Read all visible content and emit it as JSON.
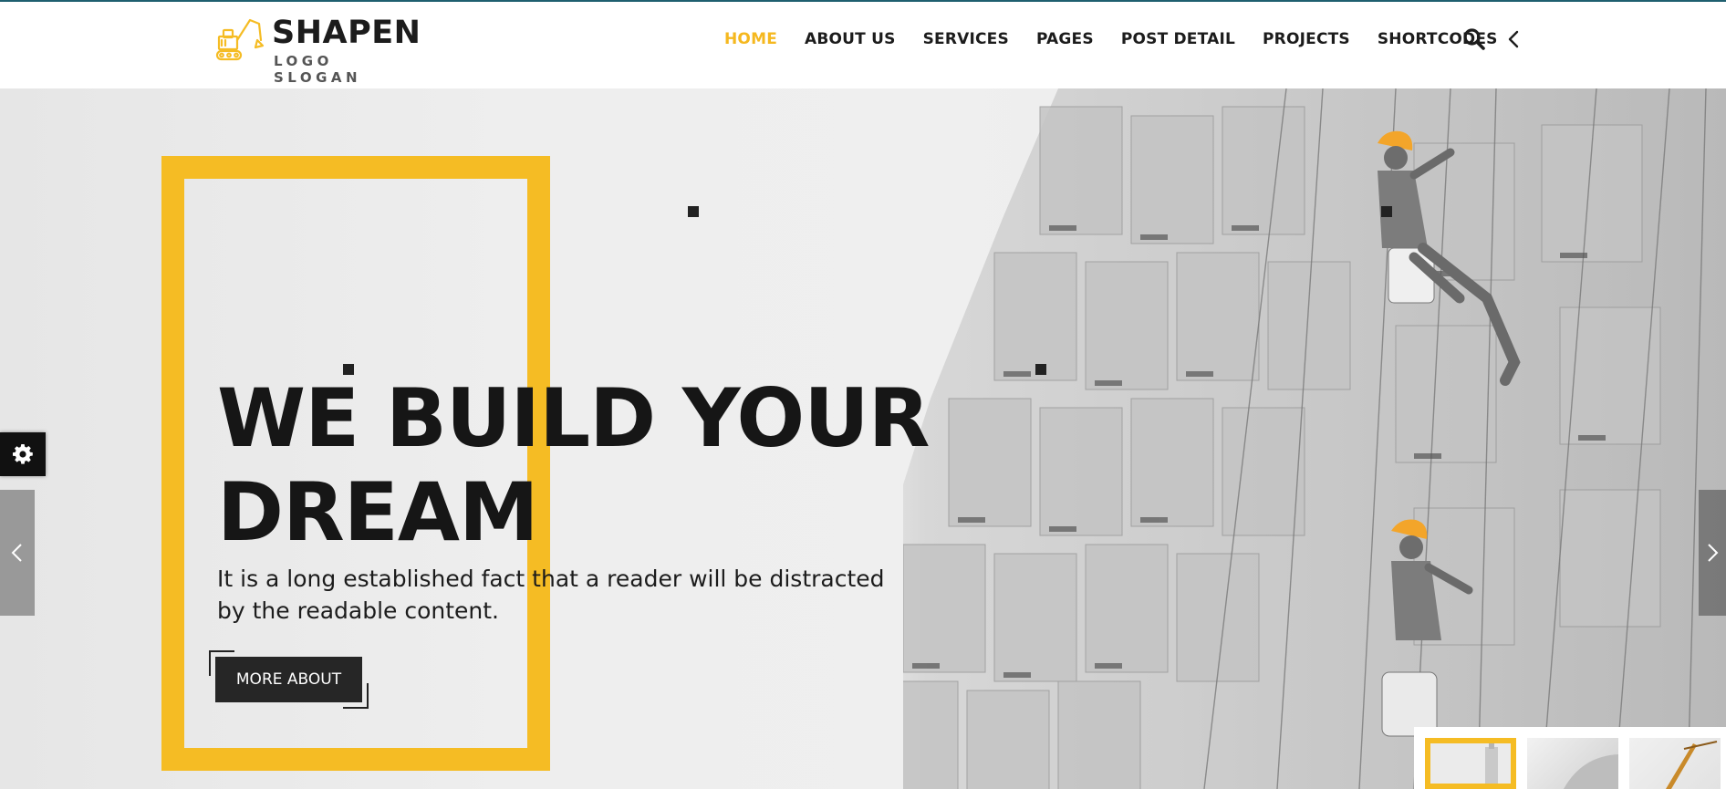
{
  "header": {
    "logo_title": "SHAPEN",
    "logo_slogan": "LOGO SLOGAN",
    "nav": [
      {
        "label": "HOME",
        "active": true
      },
      {
        "label": "ABOUT US"
      },
      {
        "label": "SERVICES"
      },
      {
        "label": "PAGES"
      },
      {
        "label": "POST DETAIL"
      },
      {
        "label": "PROJECTS"
      },
      {
        "label": "SHORTCODES"
      }
    ],
    "icons": [
      "search-icon",
      "chevron-left-icon"
    ]
  },
  "hero": {
    "headline_line1": "WE BUILD YOUR",
    "headline_line2": "DREAM",
    "subtext": "It is a long established fact that a reader will be distracted by the readable content.",
    "button_label": "MORE ABOUT",
    "slide_thumbnails": 3,
    "active_thumbnail": 1
  },
  "colors": {
    "accent": "#f5bc24",
    "text_dark": "#161616",
    "button_bg": "#262626",
    "topline": "#1f5f6f"
  },
  "widgets": {
    "settings_icon": "gear-icon",
    "prev_icon": "chevron-left-icon",
    "next_icon": "chevron-right-icon"
  }
}
